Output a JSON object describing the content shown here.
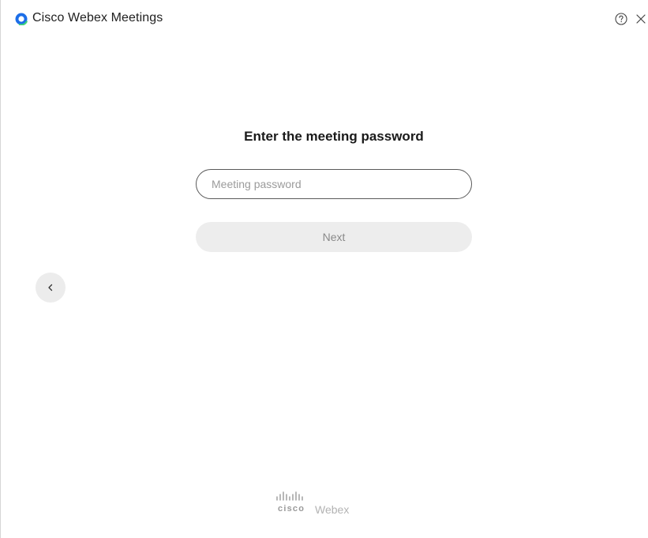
{
  "window": {
    "title": "Cisco Webex Meetings",
    "logo_icon": "webex-logo-icon",
    "help_icon": "help-circle-icon",
    "close_icon": "close-icon"
  },
  "main": {
    "heading": "Enter the meeting password",
    "password_field": {
      "placeholder": "Meeting password",
      "value": ""
    },
    "next_label": "Next",
    "back_icon": "chevron-left-icon"
  },
  "footer": {
    "brand_cisco": "cisco",
    "brand_webex": "Webex"
  },
  "colors": {
    "logo_blue": "#1c6ee8",
    "logo_green": "#3fd37b",
    "disabled_button_bg": "#ededed",
    "disabled_button_text": "#8a8a8a"
  }
}
